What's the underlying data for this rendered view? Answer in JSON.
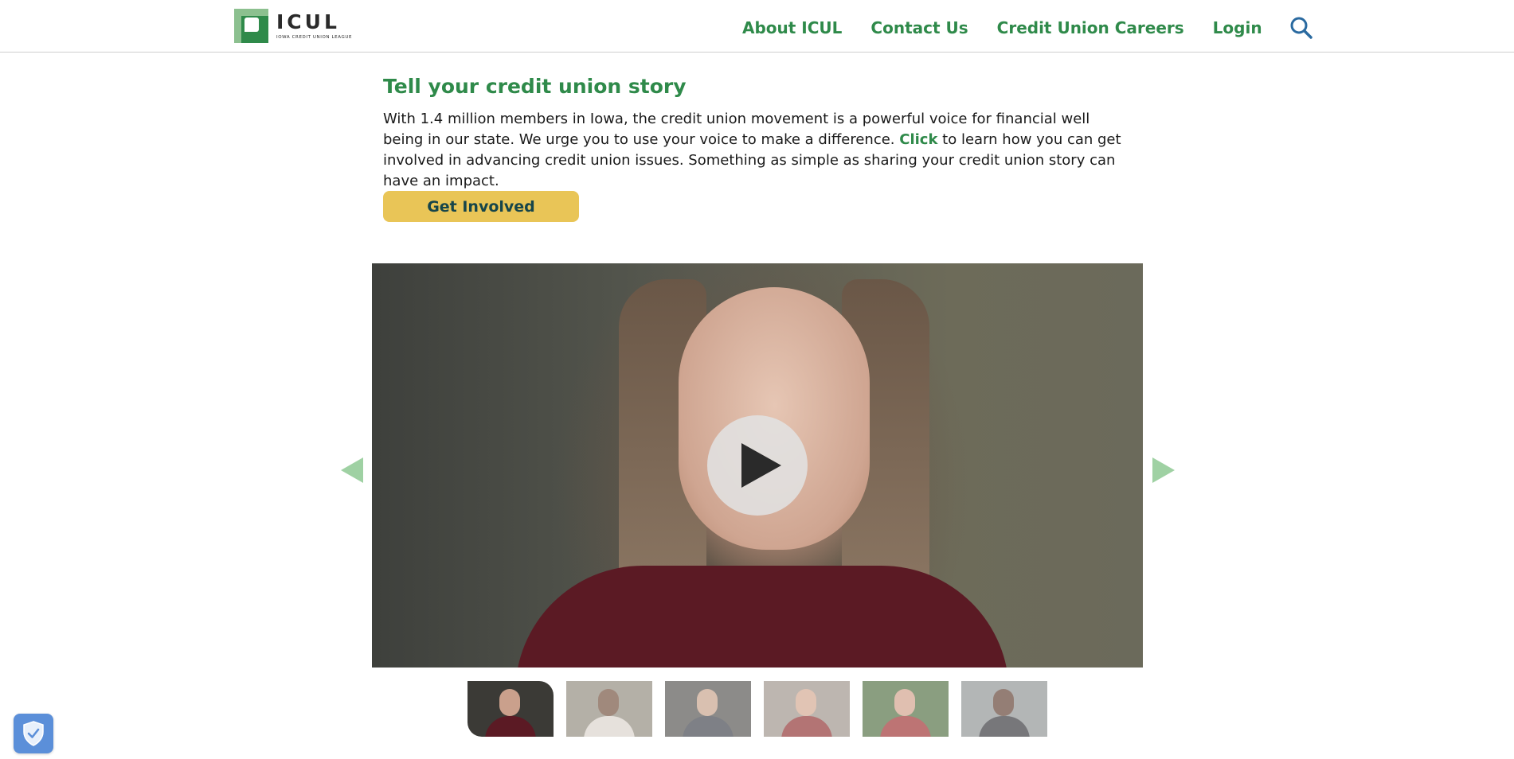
{
  "logo": {
    "name": "ICUL",
    "tagline": "IOWA CREDIT UNION LEAGUE"
  },
  "nav": {
    "items": [
      {
        "label": "About ICUL"
      },
      {
        "label": "Contact Us"
      },
      {
        "label": "Credit Union Careers"
      },
      {
        "label": "Login"
      }
    ],
    "search_icon": "search-icon"
  },
  "story": {
    "title": "Tell your credit union story",
    "body_before": "With 1.4 million members in Iowa, the credit union movement is a powerful voice for financial well being in our state. We urge you to use your voice to make a difference. ",
    "link_text": "Click",
    "body_after": " to learn how you can get involved in advancing credit union issues. Something as simple as sharing your credit union story can have an impact.",
    "button_label": "Get Involved"
  },
  "video": {
    "play_icon": "play-icon",
    "prev_icon": "arrow-left-icon",
    "next_icon": "arrow-right-icon"
  },
  "thumbnails": [
    {
      "active": true,
      "bg": "#3b3a36",
      "face": "#caa08c",
      "body": "#5b1a24"
    },
    {
      "active": false,
      "bg": "#8d8679",
      "face": "#6e4a36",
      "body": "#d9d2c9"
    },
    {
      "active": false,
      "bg": "#4f4e4b",
      "face": "#c59e86",
      "body": "#3a3d45"
    },
    {
      "active": false,
      "bg": "#9a8f86",
      "face": "#d1a58c",
      "body": "#8b2a2a"
    },
    {
      "active": false,
      "bg": "#4c6a3c",
      "face": "#cf9d86",
      "body": "#9a2a2a"
    },
    {
      "active": false,
      "bg": "#8a8f8f",
      "face": "#5b3a2b",
      "body": "#2e2e34"
    }
  ],
  "colors": {
    "brand_green": "#2f8a4a",
    "button_yellow": "#e9c557",
    "privacy_blue": "#5b8fd9"
  },
  "privacy_badge_icon": "shield-check-icon"
}
